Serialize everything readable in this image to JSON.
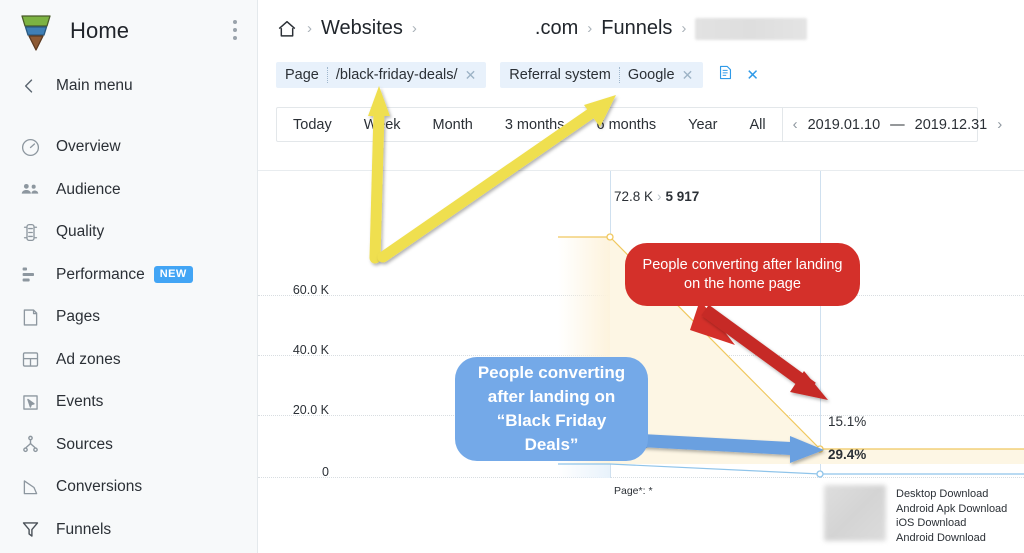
{
  "sidebar": {
    "brand": {
      "title": "Home",
      "logo_icon": "funnel-logo-icon",
      "kebab_icon": "more-vertical-icon"
    },
    "main_menu": {
      "label": "Main menu",
      "icon": "chevron-left-icon"
    },
    "items": [
      {
        "label": "Overview",
        "icon": "gauge-icon",
        "badge": ""
      },
      {
        "label": "Audience",
        "icon": "people-icon",
        "badge": ""
      },
      {
        "label": "Quality",
        "icon": "traffic-light-icon",
        "badge": ""
      },
      {
        "label": "Performance",
        "icon": "bars-icon",
        "badge": "NEW"
      },
      {
        "label": "Pages",
        "icon": "page-icon",
        "badge": ""
      },
      {
        "label": "Ad zones",
        "icon": "layout-icon",
        "badge": ""
      },
      {
        "label": "Events",
        "icon": "cursor-box-icon",
        "badge": ""
      },
      {
        "label": "Sources",
        "icon": "node-tree-icon",
        "badge": ""
      },
      {
        "label": "Conversions",
        "icon": "polygon-icon",
        "badge": ""
      },
      {
        "label": "Funnels",
        "icon": "funnel-icon",
        "badge": ""
      }
    ],
    "accent_new_badge": "#42a5f5"
  },
  "breadcrumb": {
    "home_icon": "home-icon",
    "separator": "›",
    "items": [
      {
        "label": "Websites",
        "redacted": false
      },
      {
        "label": ".com",
        "redacted": true
      },
      {
        "label": "Funnels",
        "redacted": false
      },
      {
        "label": "",
        "redacted": true
      }
    ]
  },
  "filters": {
    "chips": [
      {
        "key": "Page",
        "value": "/black-friday-deals/",
        "close_icon": "close-icon"
      },
      {
        "key": "Referral system",
        "value": "Google",
        "close_icon": "close-icon"
      }
    ],
    "actions": [
      {
        "name": "save-report-icon",
        "glyph": "🗎"
      },
      {
        "name": "clear-filters-icon",
        "glyph": "×"
      }
    ]
  },
  "period": {
    "segments": [
      "Today",
      "Week",
      "Month",
      "3 months",
      "6 months",
      "Year",
      "All"
    ],
    "prev_icon": "‹",
    "next_icon": "›",
    "range": "2019.01.10  —  2019.12.31",
    "range_start": "2019.01.10",
    "range_end": "2019.12.31",
    "range_dash": "—"
  },
  "chart_data": {
    "type": "area",
    "title": "",
    "xlabel": "",
    "ylabel": "",
    "ylim": [
      0,
      80000
    ],
    "grid": true,
    "ytick_labels": [
      "60.0 K",
      "40.0 K",
      "20.0 K",
      "0"
    ],
    "ytick_values": [
      60000,
      40000,
      20000,
      0
    ],
    "summary": {
      "total": "72.8 K",
      "arrow": "›",
      "converted": "5 917"
    },
    "step_labels": [
      "Page*: *"
    ],
    "conversion_rates": [
      {
        "label": "15.1%",
        "bold": false,
        "series": "home-page"
      },
      {
        "label": "29.4%",
        "bold": true,
        "series": "black-friday-deals"
      }
    ],
    "series": [
      {
        "name": "home-page",
        "color": "#f2c14e",
        "start": 72800,
        "end": 5917,
        "end_rate": "15.1%"
      },
      {
        "name": "black-friday-deals",
        "color": "#7fb8e6",
        "start": 0,
        "end": 0,
        "end_rate": "29.4%"
      }
    ],
    "destinations": [
      "Desktop Download",
      "Android Apk Download",
      "iOS Download",
      "Android Download"
    ]
  },
  "annotations": [
    {
      "name": "red-callout",
      "text": "People converting after landing on the home page",
      "line1": "People converting after landing",
      "line2": "on the home page",
      "color": "#d4302a",
      "arrow_color": "#c62c26"
    },
    {
      "name": "blue-callout",
      "text": "People converting after landing on “Black Friday Deals”",
      "line1": "People converting",
      "line2": "after landing on",
      "line3": "“Black Friday",
      "line4": "Deals”",
      "color": "#74a9e8",
      "arrow_color": "#6ba0e0"
    },
    {
      "name": "yellow-arrow-to-page-chip",
      "color": "#efdf4f"
    },
    {
      "name": "yellow-arrow-to-referral-chip",
      "color": "#efdf4f"
    }
  ]
}
